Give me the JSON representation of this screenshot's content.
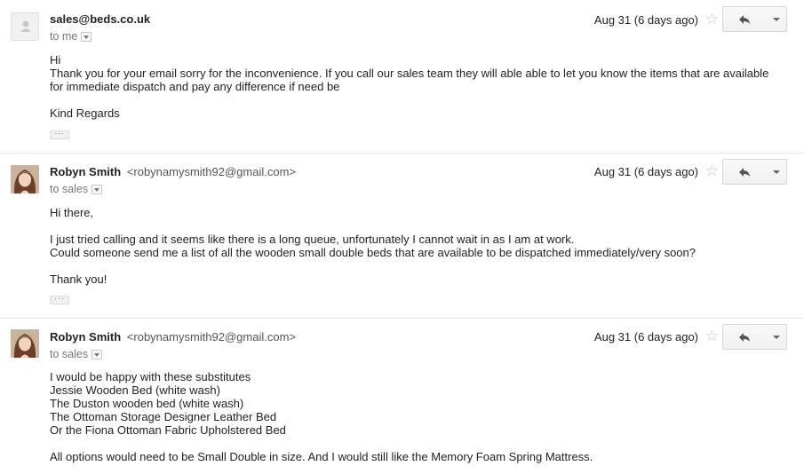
{
  "messages": [
    {
      "sender_name": "sales@beds.co.uk",
      "sender_email": "",
      "to_label": "to me",
      "date": "Aug 31 (6 days ago)",
      "avatar": "generic-person-icon",
      "body": [
        "Hi",
        "Thank you for your email sorry for the inconvenience. If you call our sales team they will able able to let you know the items that are available for immediate dispatch and pay any difference if need be",
        "Kind Regards"
      ],
      "ellipsis": "···"
    },
    {
      "sender_name": "Robyn Smith",
      "sender_email": "<robynamysmith92@gmail.com>",
      "to_label": "to sales",
      "date": "Aug 31 (6 days ago)",
      "avatar": "profile-photo",
      "body": [
        "Hi there,",
        "I just tried calling and it seems like there is a long queue, unfortunately I cannot wait in as I am at work.\nCould someone send me a list of all the wooden small double beds that are available to be dispatched immediately/very soon?",
        "Thank you!"
      ],
      "ellipsis": "···"
    },
    {
      "sender_name": "Robyn Smith",
      "sender_email": "<robynamysmith92@gmail.com>",
      "to_label": "to sales",
      "date": "Aug 31 (6 days ago)",
      "avatar": "profile-photo",
      "body": [
        "I would be happy with these substitutes\nJessie Wooden Bed (white wash)\nThe Duston wooden bed (white wash)\nThe Ottoman Storage Designer Leather Bed\nOr the Fiona Ottoman Fabric Upholstered Bed",
        "All options would need to be Small Double in size. And I would still like the Memory Foam Spring Mattress."
      ]
    }
  ],
  "icons": {
    "star": "☆",
    "reply": "reply-arrow-icon",
    "more": "chevron-down-icon"
  }
}
